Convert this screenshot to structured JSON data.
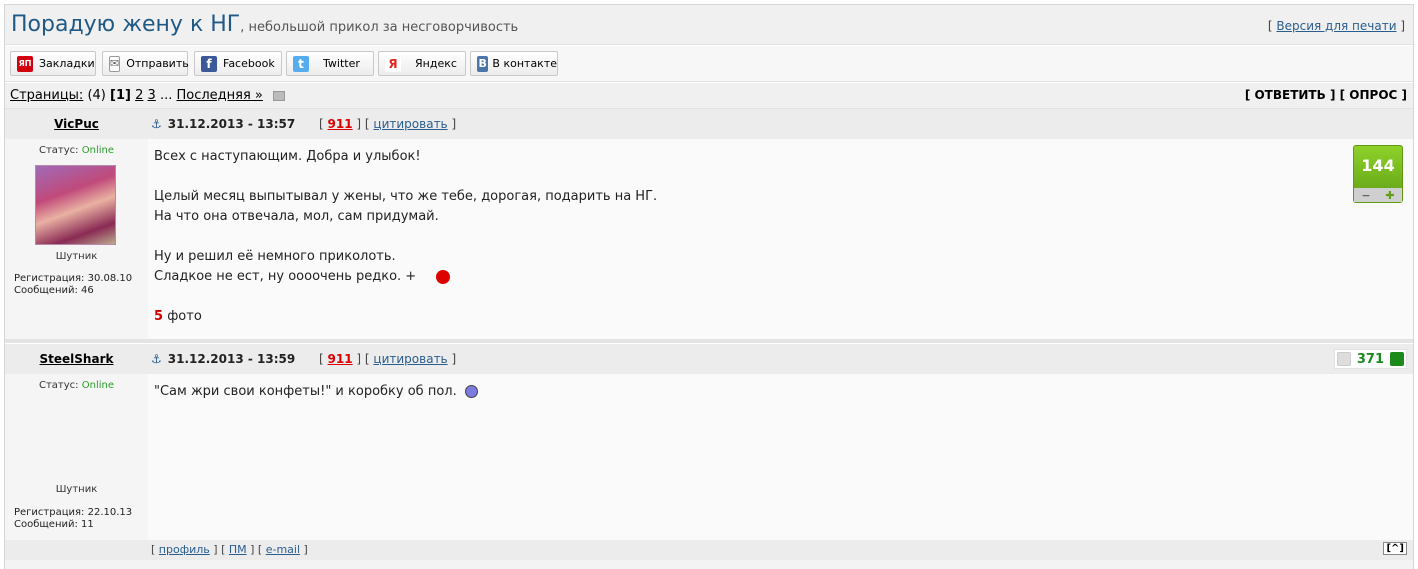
{
  "topic": {
    "title": "Порадую жену к НГ",
    "subtitle": ", небольшой прикол за несговорчивость",
    "print_prefix": "[ ",
    "print_label": "Версия для печати",
    "print_suffix": " ]"
  },
  "share": [
    {
      "label": "Закладки",
      "icon": "ЯП",
      "color": "#d2000f"
    },
    {
      "label": "Отправить",
      "icon": "✉",
      "color": "#777777"
    },
    {
      "label": "Facebook",
      "icon": "f",
      "color": "#3b5998"
    },
    {
      "label": "Twitter",
      "icon": "t",
      "color": "#55acee"
    },
    {
      "label": "Яндекс",
      "icon": "Я",
      "color": "#e52620"
    },
    {
      "label": "В контакте",
      "icon": "В",
      "color": "#4a76a8"
    }
  ],
  "pagination": {
    "label": "Страницы:",
    "count": "(4)",
    "current": "[1]",
    "p2": "2",
    "p3": "3",
    "ellipsis": "...",
    "last": "Последняя »"
  },
  "actions": {
    "reply": "[ ОТВЕТИТЬ ]",
    "poll": "[ ОПРОС ]"
  },
  "posts": [
    {
      "author": "VicPuc",
      "datetime": "31.12.2013 - 13:57",
      "post_num": "911",
      "cite": "цитировать",
      "status_label": "Статус:",
      "status_value": "Online",
      "rank": "Шутник",
      "registered": "Регистрация: 30.08.10",
      "messages": "Сообщений: 46",
      "lines": [
        "Всех с наступающим. Добра и улыбок!",
        "Целый месяц выпытывал у жены, что же тебе, дорогая, подарить на НГ.",
        "На что она отвечала, мол, сам придумай.",
        "Ну и решил её немного приколоть.",
        "Сладкое не ест, ну оооочень редко. +"
      ],
      "photo_num": "5",
      "photo_label": "фото",
      "rating": "144"
    },
    {
      "author": "SteelShark",
      "datetime": "31.12.2013 - 13:59",
      "post_num": "911",
      "cite": "цитировать",
      "status_label": "Статус:",
      "status_value": "Online",
      "rank": "Шутник",
      "registered": "Регистрация: 22.10.13",
      "messages": "Сообщений: 11",
      "lines": [
        "\"Сам жри свои конфеты!\" и коробку об пол."
      ],
      "rating": "371",
      "footer": {
        "profile": "профиль",
        "pm": "ПМ",
        "email": "e-mail",
        "top": "[^]"
      }
    }
  ],
  "colors": {
    "title": "#1f5a87",
    "online": "#2a9d2a",
    "rating_green": "#5fa014",
    "red": "#d00000"
  }
}
